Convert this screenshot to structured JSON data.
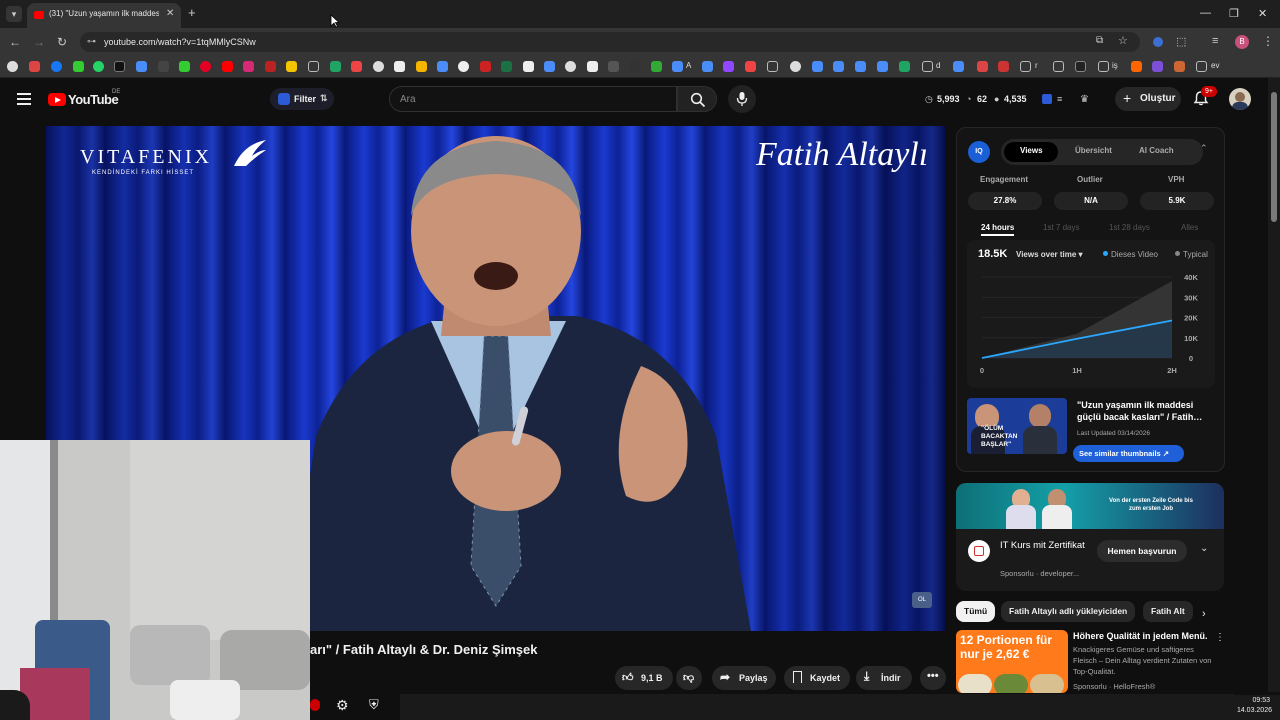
{
  "browser": {
    "tab_title": "(31) \"Uzun yaşamın ilk maddes",
    "tab_close": "✕",
    "new_tab": "+",
    "url": "youtube.com/watch?v=1tqMMlyCSNw",
    "profile_letter": "B",
    "bookmark_labels": [
      "A",
      "d",
      "r",
      "iş",
      "ev"
    ]
  },
  "header": {
    "logo_text": "YouTube",
    "region": "DE",
    "filter_label": "Filter",
    "search_placeholder": "Ara",
    "stat_views": "5,993",
    "stat_likes": "62",
    "stat_subs": "4,535",
    "create_label": "Oluştur",
    "notif_badge": "9+"
  },
  "video": {
    "brand": "VITAFENIX",
    "brand_tagline": "KENDİNDEKİ FARKI HİSSET",
    "host_signature": "Fatih Altaylı",
    "corner_bug": "OL",
    "title_visible": "arı\" / Fatih Altaylı & Dr. Deniz Şimşek"
  },
  "actions": {
    "like_count": "9,1 B",
    "share": "Paylaş",
    "save": "Kaydet",
    "download": "İndir"
  },
  "vidiq": {
    "logo": "IQ",
    "tabs": [
      "Views",
      "Übersicht",
      "AI Coach"
    ],
    "metrics": [
      {
        "label": "Engagement",
        "value": "27.8%"
      },
      {
        "label": "Outlier",
        "value": "N/A"
      },
      {
        "label": "VPH",
        "value": "5.9K"
      }
    ],
    "ranges": [
      "24 hours",
      "1st 7 days",
      "1st 28 days",
      "Alles"
    ],
    "thumb_text": "\"ÖLÜM BACAKTAN BAŞLAR\"",
    "video_title": "\"Uzun yaşamın ilk maddesi güçlü bacak kasları\" / Fatih…",
    "last_updated": "Last Updated 03/14/2026",
    "see_similar": "See similar thumbnails ↗"
  },
  "chart_data": {
    "type": "area",
    "total": "18.5K",
    "mode": "Views over time",
    "x_ticks": [
      "0",
      "1H",
      "2H"
    ],
    "y_ticks": [
      "40K",
      "30K",
      "20K",
      "10K",
      "0"
    ],
    "ylim": [
      0,
      40000
    ],
    "x": [
      0,
      1,
      2
    ],
    "series": [
      {
        "name": "Dieses Video",
        "color": "#2aa8ff",
        "values": [
          0,
          9500,
          18500
        ]
      },
      {
        "name": "Typical",
        "color": "#4a4a4a",
        "values": [
          0,
          12000,
          38000
        ]
      }
    ]
  },
  "ad": {
    "banner_text": "Von der ersten Zeile Code bis zum ersten Job",
    "title": "IT Kurs mit Zertifikat",
    "sponsor": "Sponsorlu · developer...",
    "apply": "Hemen başvurun"
  },
  "chips": [
    "Tümü",
    "Fatih Altaylı adlı yükleyiciden",
    "Fatih Alt"
  ],
  "recommendation": {
    "thumb_text": "12 Portionen für nur je 2,62 €",
    "title": "Höhere Qualität in jedem Menü.",
    "desc": "Knackigeres Gemüse und saftigeres Fleisch – Dein Alltag verdient Zutaten von Top-Qualität.",
    "sponsor": "Sponsorlu · HelloFresh®"
  },
  "clock": {
    "time": "09:53",
    "date": "14.03.2026"
  }
}
